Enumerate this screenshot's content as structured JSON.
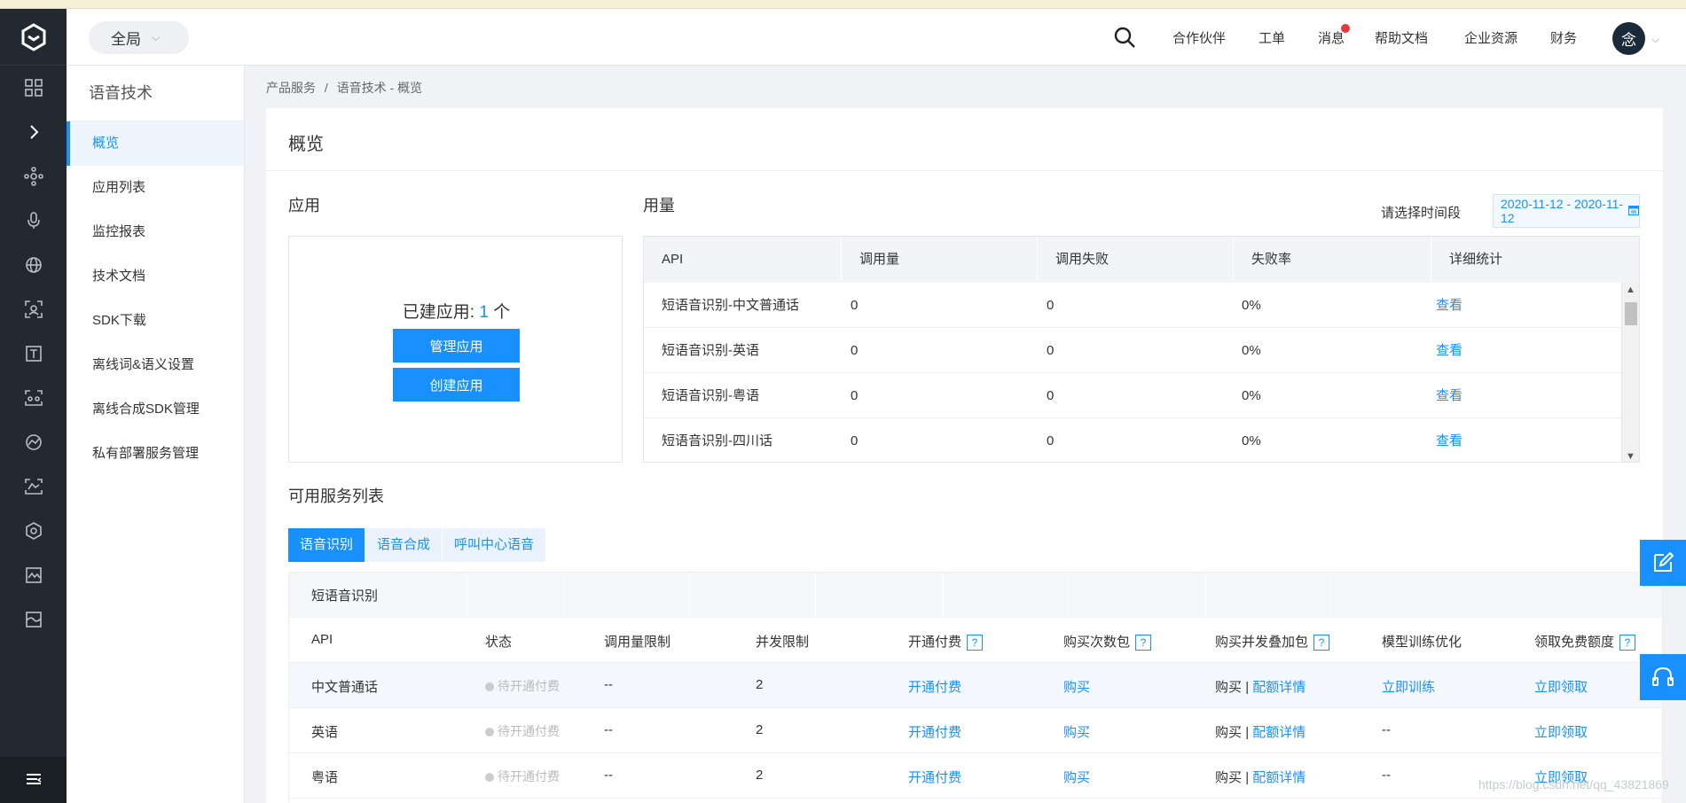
{
  "header": {
    "scope": "全局",
    "nav": [
      "合作伙伴",
      "工单",
      "消息",
      "帮助文档",
      "企业资源",
      "财务"
    ],
    "avatar_char": "念"
  },
  "rail_icons": [
    "grid-icon",
    "expand-icon",
    "network-icon",
    "microphone-icon",
    "globe-icon",
    "face-scan-icon",
    "text-icon",
    "vision-icon",
    "chart-icon",
    "camera-icon",
    "cube-icon",
    "image-icon",
    "landscape-icon"
  ],
  "sidebar": {
    "title": "语音技术",
    "items": [
      "概览",
      "应用列表",
      "监控报表",
      "技术文档",
      "SDK下载",
      "离线词&语义设置",
      "离线合成SDK管理",
      "私有部署服务管理"
    ],
    "active_index": 0
  },
  "breadcrumb": {
    "root": "产品服务",
    "sep": "/",
    "current": "语音技术 - 概览"
  },
  "page": {
    "title": "概览",
    "apps_title": "应用",
    "usage_title": "用量",
    "services_title": "可用服务列表"
  },
  "apps": {
    "count_prefix": "已建应用:",
    "count": "1",
    "count_suffix": "个",
    "manage_label": "管理应用",
    "create_label": "创建应用"
  },
  "usage": {
    "date_label": "请选择时间段",
    "date_range": "2020-11-12 - 2020-11-12",
    "columns": [
      "API",
      "调用量",
      "调用失败",
      "失败率",
      "详细统计"
    ],
    "rows": [
      [
        "短语音识别-中文普通话",
        "0",
        "0",
        "0%",
        "查看"
      ],
      [
        "短语音识别-英语",
        "0",
        "0",
        "0%",
        "查看"
      ],
      [
        "短语音识别-粤语",
        "0",
        "0",
        "0%",
        "查看"
      ],
      [
        "短语音识别-四川话",
        "0",
        "0",
        "0%",
        "查看"
      ]
    ]
  },
  "service_tabs": [
    "语音识别",
    "语音合成",
    "呼叫中心语音"
  ],
  "services": {
    "group": "短语音识别",
    "columns": [
      "API",
      "状态",
      "调用量限制",
      "并发限制",
      "开通付费",
      "购买次数包",
      "购买并发叠加包",
      "模型训练优化",
      "领取免费额度"
    ],
    "rows": [
      {
        "api": "中文普通话",
        "status": "待开通付费",
        "limit": "--",
        "concurrency": "2",
        "pay": "开通付费",
        "buy": "购买",
        "buy2": "购买",
        "sep": "|",
        "quota": "配额详情",
        "train": "立即训练",
        "free": "立即领取"
      },
      {
        "api": "英语",
        "status": "待开通付费",
        "limit": "--",
        "concurrency": "2",
        "pay": "开通付费",
        "buy": "购买",
        "buy2": "购买",
        "sep": "|",
        "quota": "配额详情",
        "train": "--",
        "free": "立即领取"
      },
      {
        "api": "粤语",
        "status": "待开通付费",
        "limit": "--",
        "concurrency": "2",
        "pay": "开通付费",
        "buy": "购买",
        "buy2": "购买",
        "sep": "|",
        "quota": "配额详情",
        "train": "--",
        "free": "立即领取"
      }
    ]
  },
  "watermark": "https://blog.csdn.net/qq_43821869",
  "colors": {
    "accent": "#1890ff",
    "rail": "#232930",
    "badge": "#e8383d"
  }
}
